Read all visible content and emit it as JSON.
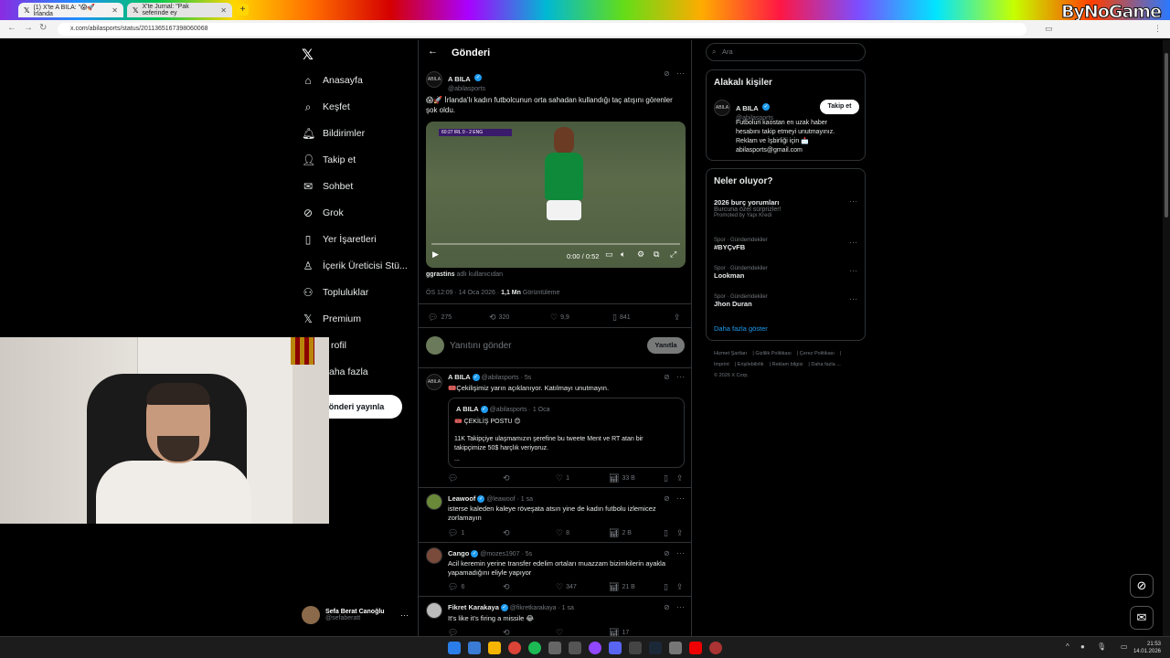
{
  "browser": {
    "tabs": [
      {
        "label": "(1) X'te A BILA: \"😱🚀 İrlanda"
      },
      {
        "label": "X'te Jurnal: \"Pak seferinde ey"
      }
    ],
    "url": "x.com/abilasports/status/2011365167398060068",
    "brand": "ByNoGame"
  },
  "nav": {
    "items": [
      {
        "label": "Anasayfa",
        "icon": "home-icon"
      },
      {
        "label": "Keşfet",
        "icon": "search-icon"
      },
      {
        "label": "Bildirimler",
        "icon": "bell-icon"
      },
      {
        "label": "Takip et",
        "icon": "person-plus-icon"
      },
      {
        "label": "Sohbet",
        "icon": "mail-icon"
      },
      {
        "label": "Grok",
        "icon": "grok-icon"
      },
      {
        "label": "Yer İşaretleri",
        "icon": "bookmark-icon"
      },
      {
        "label": "İçerik Üreticisi Stü...",
        "icon": "creator-icon"
      },
      {
        "label": "Topluluklar",
        "icon": "community-icon"
      },
      {
        "label": "Premium",
        "icon": "x-icon"
      },
      {
        "label": "rofil",
        "icon": "profile-icon"
      },
      {
        "label": "aha fazla",
        "icon": "more-icon"
      }
    ],
    "post_button": "önderi yayınla",
    "account": {
      "name": "Sefa Berat Canoğlu",
      "handle": "@sefaberatt"
    }
  },
  "main": {
    "header_title": "Gönderi",
    "post": {
      "author": "A BILA",
      "handle": "@abilasports",
      "text": "😱🚀 İrlanda'lı kadın futbolcunun orta sahadan kullandığı taç atışını görenler şok oldu.",
      "video_time": "0:00 / 0:52",
      "video_score": "60:27  IRL  0 - 2  ENG",
      "attribution_user": "ggrastins",
      "attribution_text": "adlı kullanıcıdan",
      "timestamp": "ÖS 12:09 · 14 Oca 2026 ·",
      "views_count": "1,1 Mn",
      "views_label": "Görüntüleme",
      "stats": {
        "replies": "275",
        "reposts": "320",
        "likes": "9,9",
        "bookmarks": "841"
      }
    },
    "reply_box": {
      "placeholder": "Yanıtını gönder",
      "button": "Yanıtla"
    },
    "replies": [
      {
        "author": "A BILA",
        "handle": "@abilasports · 5s",
        "text": "🎟️Çekilişimiz yarın açıklanıyor. Katılmayı unutmayın.",
        "quote": {
          "author": "A BILA",
          "handle": "@abilasports · 1 Oca",
          "line1": "🎟️ ÇEKİLİŞ POSTU 😊",
          "line2": "11K Takipçiye ulaşmamızın şerefine bu tweete Ment ve RT atan bir takipçimize 50$ harçlık veriyoruz.",
          "line3": "..."
        },
        "stats": {
          "replies": "",
          "reposts": "",
          "likes": "1",
          "views": "33 B"
        }
      },
      {
        "author": "Leawoof",
        "handle": "@leawoof · 1 sa",
        "text": "isterse kaleden kaleye röveşata atsın yine de kadın futbolu izlemicez zorlamayın",
        "stats": {
          "replies": "1",
          "reposts": "",
          "likes": "8",
          "views": "2 B"
        }
      },
      {
        "author": "Cango",
        "handle": "@mozes1907 · 5s",
        "text": "Acil keremin yerine transfer edelim ortaları muazzam bizimkilerin ayakla yapamadığını eliyle yapıyor",
        "stats": {
          "replies": "6",
          "reposts": "",
          "likes": "347",
          "views": "21 B"
        }
      },
      {
        "author": "Fikret Karakaya",
        "handle": "@fikretkarakaya · 1 sa",
        "text": "It's like it's firing a missile 😂",
        "stats": {
          "replies": "",
          "reposts": "",
          "likes": "",
          "views": "17"
        }
      }
    ]
  },
  "sidebar": {
    "search_placeholder": "Ara",
    "related_title": "Alakalı kişiler",
    "related": {
      "name": "A BILA",
      "handle": "@abilasports",
      "follow": "Takip et",
      "bio_line1": "Futbolun kaostan en uzak haber",
      "bio_line2": "hesabını takip etmeyi unutmayınız.",
      "bio_line3": "Reklam ve İşbirliği için 📩",
      "bio_line4": "abilasports@gmail.com"
    },
    "trends_title": "Neler oluyor?",
    "trends": [
      {
        "category": "",
        "name": "2026 burç yorumları",
        "sub": "Burcuna özel sürprizler!",
        "promo": "Promoted by Yapı Kredi"
      },
      {
        "category": "Spor · Gündemdekiler",
        "name": "#BYÇvFB",
        "sub": "",
        "promo": ""
      },
      {
        "category": "Spor · Gündemdekiler",
        "name": "Lookman",
        "sub": "",
        "promo": ""
      },
      {
        "category": "Spor · Gündemdekiler",
        "name": "Jhon Duran",
        "sub": "",
        "promo": ""
      }
    ],
    "show_more": "Daha fazla göster",
    "footer": {
      "l1": "Hizmet Şartları",
      "l2": "Gizlilik Politikası",
      "l3": "Çerez Politikası",
      "l4": "Imprint",
      "l5": "Erişilebilirlik",
      "l6": "Reklam bilgisi",
      "l7": "Daha fazla ...",
      "copy": "© 2026 X Corp."
    }
  },
  "taskbar": {
    "time": "21:53",
    "date": "14.01.2026"
  }
}
